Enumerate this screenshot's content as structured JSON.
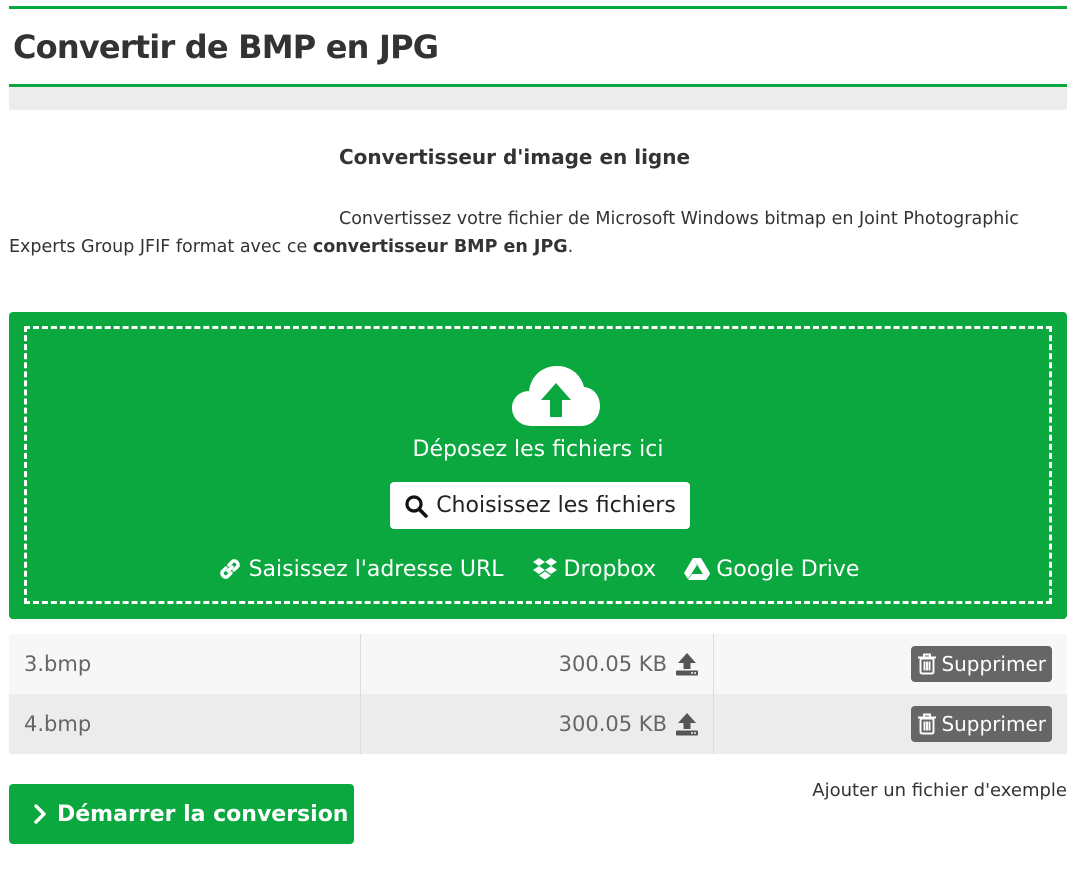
{
  "page": {
    "title": "Convertir de BMP en JPG"
  },
  "intro": {
    "heading": "Convertisseur d'image en ligne",
    "text_before": "Convertissez votre fichier de Microsoft Windows bitmap en Joint Photographic Experts Group JFIF format avec ce ",
    "text_bold": "convertisseur BMP en JPG",
    "text_after": "."
  },
  "dropzone": {
    "drop_text": "Déposez les fichiers ici",
    "choose_label": "Choisissez les fichiers",
    "sources": {
      "url_label": "Saisissez l'adresse URL",
      "dropbox_label": "Dropbox",
      "gdrive_label": "Google Drive"
    }
  },
  "files": [
    {
      "name": "3.bmp",
      "size": "300.05 KB",
      "delete_label": "Supprimer"
    },
    {
      "name": "4.bmp",
      "size": "300.05 KB",
      "delete_label": "Supprimer"
    }
  ],
  "actions": {
    "start_label": "Démarrer la conversion",
    "sample_label": "Ajouter un fichier d'exemple"
  },
  "colors": {
    "accent": "#0aa83f",
    "delete_button": "#666666"
  },
  "icons": [
    "cloud-upload-icon",
    "search-icon",
    "link-icon",
    "dropbox-icon",
    "google-drive-icon",
    "upload-icon",
    "trash-icon",
    "chevron-right-icon"
  ]
}
